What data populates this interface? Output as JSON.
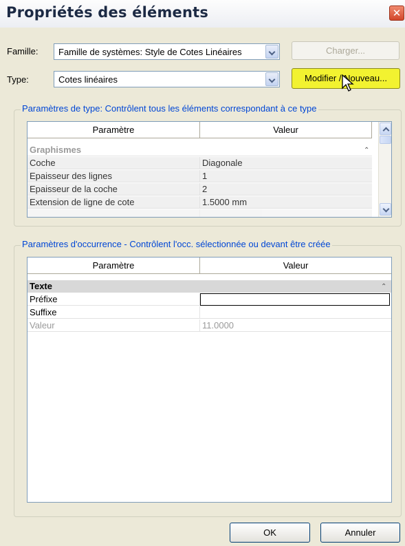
{
  "window": {
    "title": "Propriétés des éléments",
    "close_glyph": "✕"
  },
  "famille": {
    "label": "Famille:",
    "value": "Famille de systèmes: Style de Cotes Linéaires",
    "charger_label": "Charger..."
  },
  "type": {
    "label": "Type:",
    "value": "Cotes linéaires",
    "modifier_label": "Modifier / Nouveau..."
  },
  "type_params": {
    "legend": "Paramètres de type: Contrôlent tous les éléments correspondant à ce type",
    "col_param": "Paramètre",
    "col_value": "Valeur",
    "group": "Graphismes",
    "rows": [
      {
        "name": "Coche",
        "value": "Diagonale"
      },
      {
        "name": "Epaisseur des lignes",
        "value": "1"
      },
      {
        "name": "Epaisseur de la coche",
        "value": "2"
      },
      {
        "name": "Extension de ligne de cote",
        "value": "1.5000 mm"
      }
    ]
  },
  "instance_params": {
    "legend": "Paramètres d'occurrence - Contrôlent l'occ. sélectionnée ou devant être créée",
    "col_param": "Paramètre",
    "col_value": "Valeur",
    "group": "Texte",
    "rows": [
      {
        "name": "Préfixe",
        "value": ""
      },
      {
        "name": "Suffixe",
        "value": ""
      },
      {
        "name": "Valeur",
        "value": "11.0000"
      }
    ]
  },
  "footer": {
    "ok_label": "OK",
    "cancel_label": "Annuler"
  },
  "colors": {
    "legend_text": "#0046d5",
    "dialog_bg": "#ece9d8",
    "highlight_button": "#f2f230"
  },
  "icons": {
    "close": "close-icon",
    "dropdown": "chevron-down-icon",
    "collapse": "double-chevron-up-icon",
    "cursor": "mouse-pointer-icon"
  }
}
